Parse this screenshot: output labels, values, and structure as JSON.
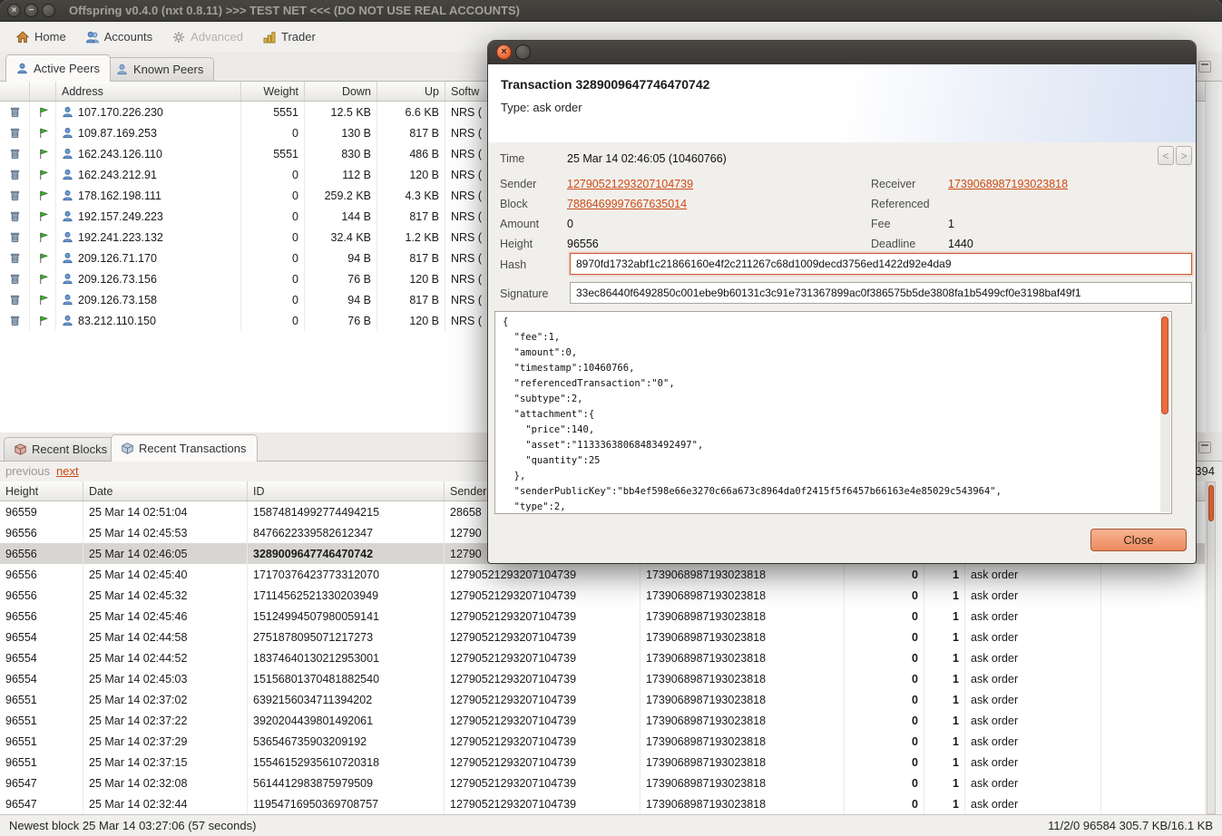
{
  "icons": {
    "close": "×",
    "minimize": "−",
    "maximize": "",
    "prev": "<",
    "next": ">"
  },
  "titlebar": {
    "title": "Offspring v0.4.0 (nxt 0.8.11) >>> TEST NET <<< (DO NOT USE REAL ACCOUNTS)"
  },
  "menu": {
    "items": [
      {
        "label": "Home"
      },
      {
        "label": "Accounts"
      },
      {
        "label": "Advanced"
      },
      {
        "label": "Trader"
      }
    ]
  },
  "peers_panel": {
    "tabs": [
      {
        "label": "Active Peers"
      },
      {
        "label": "Known Peers"
      }
    ],
    "columns": {
      "address": "Address",
      "weight": "Weight",
      "down": "Down",
      "up": "Up",
      "software": "Softw"
    },
    "rows": [
      {
        "address": "107.170.226.230",
        "weight": "5551",
        "down": "12.5 KB",
        "up": "6.6 KB",
        "software": "NRS ("
      },
      {
        "address": "109.87.169.253",
        "weight": "0",
        "down": "130 B",
        "up": "817 B",
        "software": "NRS ("
      },
      {
        "address": "162.243.126.110",
        "weight": "5551",
        "down": "830 B",
        "up": "486 B",
        "software": "NRS ("
      },
      {
        "address": "162.243.212.91",
        "weight": "0",
        "down": "112 B",
        "up": "120 B",
        "software": "NRS ("
      },
      {
        "address": "178.162.198.111",
        "weight": "0",
        "down": "259.2 KB",
        "up": "4.3 KB",
        "software": "NRS ("
      },
      {
        "address": "192.157.249.223",
        "weight": "0",
        "down": "144 B",
        "up": "817 B",
        "software": "NRS ("
      },
      {
        "address": "192.241.223.132",
        "weight": "0",
        "down": "32.4 KB",
        "up": "1.2 KB",
        "software": "NRS ("
      },
      {
        "address": "209.126.71.170",
        "weight": "0",
        "down": "94 B",
        "up": "817 B",
        "software": "NRS ("
      },
      {
        "address": "209.126.73.156",
        "weight": "0",
        "down": "76 B",
        "up": "120 B",
        "software": "NRS ("
      },
      {
        "address": "209.126.73.158",
        "weight": "0",
        "down": "94 B",
        "up": "817 B",
        "software": "NRS ("
      },
      {
        "address": "83.212.110.150",
        "weight": "0",
        "down": "76 B",
        "up": "120 B",
        "software": "NRS ("
      }
    ]
  },
  "tx_panel": {
    "tabs": [
      {
        "label": "Recent Blocks"
      },
      {
        "label": "Recent Transactions"
      }
    ],
    "pagination": {
      "previous": "previous",
      "next": "next",
      "right_fragment": "394"
    },
    "columns": {
      "height": "Height",
      "date": "Date",
      "id": "ID",
      "sender": "Sender",
      "receiver": "Receiver",
      "amount": "Amount",
      "fee": "Fee",
      "type": "Type"
    },
    "rows": [
      {
        "height": "96559",
        "date": "25 Mar 14 02:51:04",
        "id": "15874814992774494215",
        "sender": "28658",
        "receiver": "",
        "amount": "",
        "fee": "",
        "type": "",
        "selected": false
      },
      {
        "height": "96556",
        "date": "25 Mar 14 02:45:53",
        "id": "8476622339582612347",
        "sender": "12790",
        "receiver": "",
        "amount": "",
        "fee": "",
        "type": "",
        "selected": false
      },
      {
        "height": "96556",
        "date": "25 Mar 14 02:46:05",
        "id": "3289009647746470742",
        "sender": "12790",
        "receiver": "",
        "amount": "",
        "fee": "",
        "type": "",
        "selected": true
      },
      {
        "height": "96556",
        "date": "25 Mar 14 02:45:40",
        "id": "17170376423773312070",
        "sender": "12790521293207104739",
        "receiver": "1739068987193023818",
        "amount": "0",
        "fee": "1",
        "type": "ask order",
        "selected": false
      },
      {
        "height": "96556",
        "date": "25 Mar 14 02:45:32",
        "id": "17114562521330203949",
        "sender": "12790521293207104739",
        "receiver": "1739068987193023818",
        "amount": "0",
        "fee": "1",
        "type": "ask order",
        "selected": false
      },
      {
        "height": "96556",
        "date": "25 Mar 14 02:45:46",
        "id": "15124994507980059141",
        "sender": "12790521293207104739",
        "receiver": "1739068987193023818",
        "amount": "0",
        "fee": "1",
        "type": "ask order",
        "selected": false
      },
      {
        "height": "96554",
        "date": "25 Mar 14 02:44:58",
        "id": "2751878095071217273",
        "sender": "12790521293207104739",
        "receiver": "1739068987193023818",
        "amount": "0",
        "fee": "1",
        "type": "ask order",
        "selected": false
      },
      {
        "height": "96554",
        "date": "25 Mar 14 02:44:52",
        "id": "18374640130212953001",
        "sender": "12790521293207104739",
        "receiver": "1739068987193023818",
        "amount": "0",
        "fee": "1",
        "type": "ask order",
        "selected": false
      },
      {
        "height": "96554",
        "date": "25 Mar 14 02:45:03",
        "id": "15156801370481882540",
        "sender": "12790521293207104739",
        "receiver": "1739068987193023818",
        "amount": "0",
        "fee": "1",
        "type": "ask order",
        "selected": false
      },
      {
        "height": "96551",
        "date": "25 Mar 14 02:37:02",
        "id": "6392156034711394202",
        "sender": "12790521293207104739",
        "receiver": "1739068987193023818",
        "amount": "0",
        "fee": "1",
        "type": "ask order",
        "selected": false
      },
      {
        "height": "96551",
        "date": "25 Mar 14 02:37:22",
        "id": "3920204439801492061",
        "sender": "12790521293207104739",
        "receiver": "1739068987193023818",
        "amount": "0",
        "fee": "1",
        "type": "ask order",
        "selected": false
      },
      {
        "height": "96551",
        "date": "25 Mar 14 02:37:29",
        "id": "536546735903209192",
        "sender": "12790521293207104739",
        "receiver": "1739068987193023818",
        "amount": "0",
        "fee": "1",
        "type": "ask order",
        "selected": false
      },
      {
        "height": "96551",
        "date": "25 Mar 14 02:37:15",
        "id": "15546152935610720318",
        "sender": "12790521293207104739",
        "receiver": "1739068987193023818",
        "amount": "0",
        "fee": "1",
        "type": "ask order",
        "selected": false
      },
      {
        "height": "96547",
        "date": "25 Mar 14 02:32:08",
        "id": "5614412983875979509",
        "sender": "12790521293207104739",
        "receiver": "1739068987193023818",
        "amount": "0",
        "fee": "1",
        "type": "ask order",
        "selected": false
      },
      {
        "height": "96547",
        "date": "25 Mar 14 02:32:44",
        "id": "11954716950369708757",
        "sender": "12790521293207104739",
        "receiver": "1739068987193023818",
        "amount": "0",
        "fee": "1",
        "type": "ask order",
        "selected": false
      }
    ]
  },
  "dialog": {
    "title": "Transaction 3289009647746470742",
    "subtitle": "Type: ask order",
    "fields": {
      "time": {
        "label": "Time",
        "value": "25 Mar 14 02:46:05 (10460766)"
      },
      "sender": {
        "label": "Sender",
        "value": "12790521293207104739"
      },
      "receiver": {
        "label": "Receiver",
        "value": "1739068987193023818"
      },
      "block": {
        "label": "Block",
        "value": "7886469997667635014"
      },
      "referenced": {
        "label": "Referenced",
        "value": ""
      },
      "amount": {
        "label": "Amount",
        "value": "0"
      },
      "fee": {
        "label": "Fee",
        "value": "1"
      },
      "height": {
        "label": "Height",
        "value": "96556"
      },
      "deadline": {
        "label": "Deadline",
        "value": "1440"
      },
      "hash": {
        "label": "Hash",
        "value": "8970fd1732abf1c21866160e4f2c211267c68d1009decd3756ed1422d92e4da9"
      },
      "signature": {
        "label": "Signature",
        "value": "33ec86440f6492850c001ebe9b60131c3c91e731367899ac0f386575b5de3808fa1b5499cf0e3198baf49f1"
      }
    },
    "json_text": "{\n  \"fee\":1,\n  \"amount\":0,\n  \"timestamp\":10460766,\n  \"referencedTransaction\":\"0\",\n  \"subtype\":2,\n  \"attachment\":{\n    \"price\":140,\n    \"asset\":\"11333638068483492497\",\n    \"quantity\":25\n  },\n  \"senderPublicKey\":\"bb4ef598e66e3270c66a673c8964da0f2415f5f6457b66163e4e85029c543964\",\n  \"type\":2,",
    "close_label": "Close"
  },
  "statusbar": {
    "left": "Newest block 25 Mar 14 03:27:06 (57 seconds)",
    "right": "11/2/0  96584  305.7 KB/16.1 KB"
  }
}
